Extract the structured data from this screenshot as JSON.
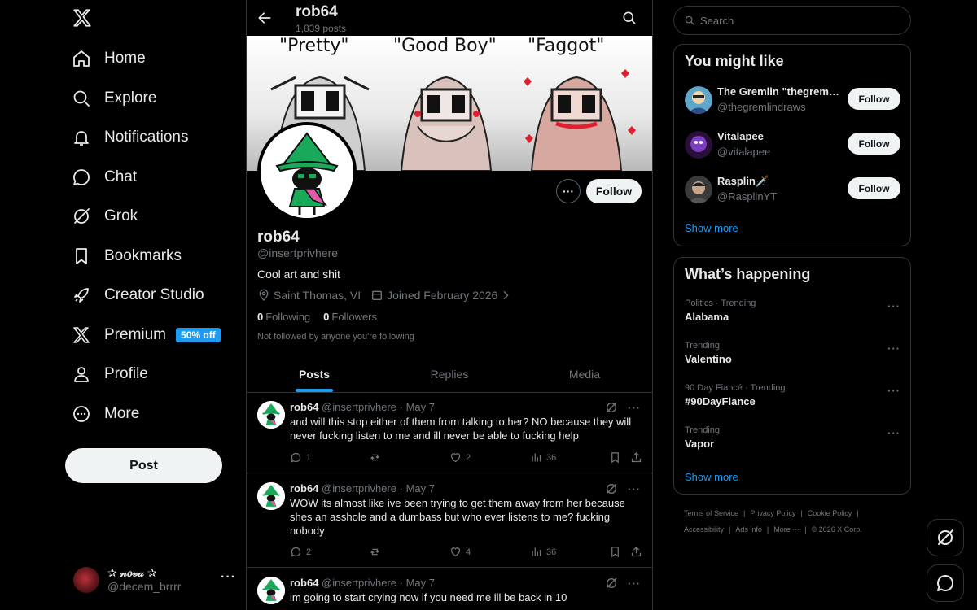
{
  "nav": {
    "items": [
      {
        "label": "Home",
        "icon": "home-icon"
      },
      {
        "label": "Explore",
        "icon": "search-icon"
      },
      {
        "label": "Notifications",
        "icon": "bell-icon"
      },
      {
        "label": "Chat",
        "icon": "chat-bubble-icon"
      },
      {
        "label": "Grok",
        "icon": "grok-icon"
      },
      {
        "label": "Bookmarks",
        "icon": "bookmark-icon"
      },
      {
        "label": "Creator Studio",
        "icon": "rocket-icon"
      },
      {
        "label": "Premium",
        "icon": "x-icon",
        "badge": "50% off"
      },
      {
        "label": "Profile",
        "icon": "person-icon"
      },
      {
        "label": "More",
        "icon": "more-circle-icon"
      }
    ],
    "post_label": "Post",
    "account": {
      "name": "✰ 𝓃𝑜𝓋𝒶 ✰",
      "handle": "@decem_brrrr"
    }
  },
  "header": {
    "name": "rob64",
    "posts_count": "1,839 posts"
  },
  "banner": {
    "labels": [
      "\"Pretty\"",
      "\"Good Boy\"",
      "\"Faggot\""
    ]
  },
  "profile": {
    "follow_label": "Follow",
    "name": "rob64",
    "handle": "@insertprivhere",
    "bio": "Cool art and shit",
    "location": "Saint Thomas, VI",
    "joined": "Joined February 2026",
    "following_count": "0",
    "following_label": "Following",
    "followers_count": "0",
    "followers_label": "Followers",
    "not_followed": "Not followed by anyone you're following"
  },
  "tabs": [
    "Posts",
    "Replies",
    "Media"
  ],
  "tweets": [
    {
      "name": "rob64",
      "handle": "@insertprivhere",
      "date": "May 7",
      "text": "and will this stop either of them from talking to her? NO because they will never fucking listen to me and ill never be able to fucking help",
      "replies": "1",
      "reposts": "",
      "likes": "2",
      "views": "36"
    },
    {
      "name": "rob64",
      "handle": "@insertprivhere",
      "date": "May 7",
      "text": "WOW its almost like ive been trying to get them away from her because shes an asshole and a dumbass but who ever listens to me? fucking nobody",
      "replies": "2",
      "reposts": "",
      "likes": "4",
      "views": "36"
    },
    {
      "name": "rob64",
      "handle": "@insertprivhere",
      "date": "May 7",
      "text": "im going to start crying now if you need me ill be back in 10",
      "replies": "",
      "reposts": "",
      "likes": "",
      "views": ""
    }
  ],
  "search": {
    "placeholder": "Search"
  },
  "you_might_like": {
    "title": "You might like",
    "suggestions": [
      {
        "name": "The Gremlin \"thegremlindraws\"",
        "handle": "@thegremlindraws",
        "follow": "Follow"
      },
      {
        "name": "Vitalapee",
        "handle": "@vitalapee",
        "follow": "Follow"
      },
      {
        "name": "Rasplin🗡️",
        "handle": "@RasplinYT",
        "follow": "Follow"
      }
    ],
    "show_more": "Show more"
  },
  "whats_happening": {
    "title": "What’s happening",
    "trends": [
      {
        "category": "Politics · Trending",
        "name": "Alabama"
      },
      {
        "category": "Trending",
        "name": "Valentino"
      },
      {
        "category": "90 Day Fiancé · Trending",
        "name": "#90DayFiance"
      },
      {
        "category": "Trending",
        "name": "Vapor"
      }
    ],
    "show_more": "Show more"
  },
  "footer": {
    "line1": [
      "Terms of Service",
      "Privacy Policy",
      "Cookie Policy"
    ],
    "line2": [
      "Accessibility",
      "Ads info",
      "More ···",
      "© 2026 X Corp."
    ]
  },
  "colors": {
    "accent": "#1d9bf0",
    "background": "#000000",
    "border": "#2f3336",
    "muted": "#71767b",
    "text": "#e7e9ea",
    "button_light": "#eff3f4"
  }
}
